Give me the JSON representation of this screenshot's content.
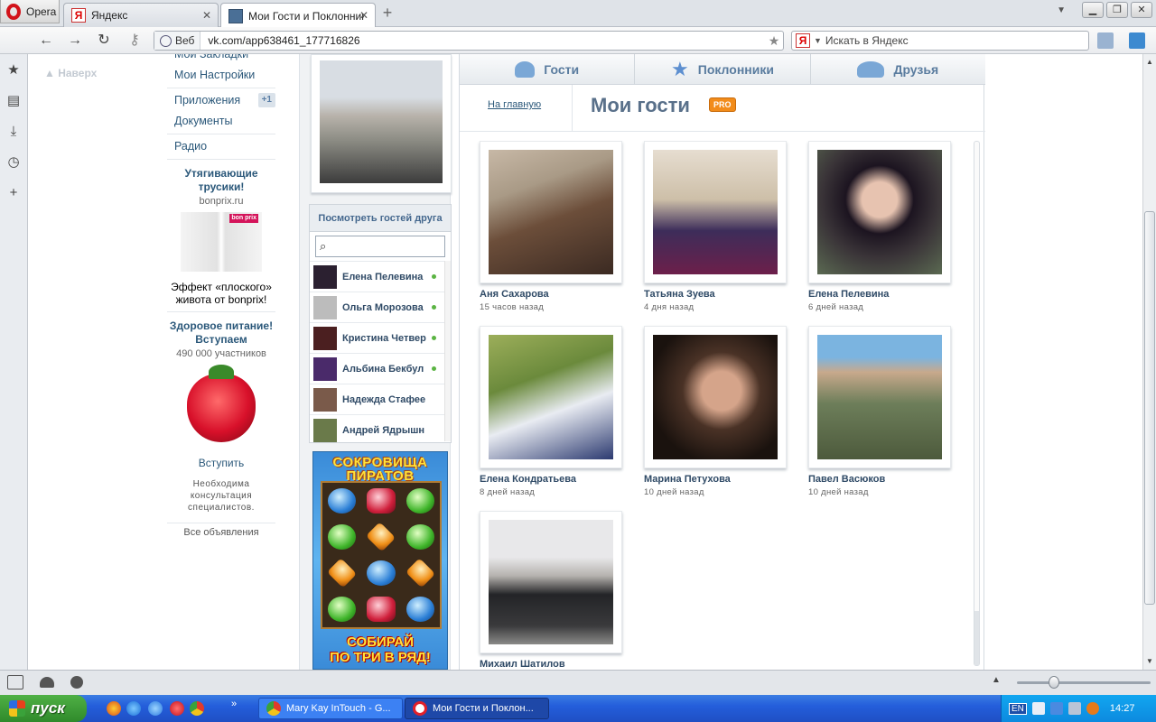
{
  "browser": {
    "menu_label": "Opera",
    "tabs": [
      {
        "title": "Яндекс",
        "favicon": "Я"
      },
      {
        "title": "Мои Гости и Поклонники"
      }
    ],
    "address": {
      "security_label": "Веб",
      "url": "vk.com/app638461_177716826"
    },
    "search": {
      "engine_letter": "Я",
      "placeholder": "Искать в Яндекс"
    }
  },
  "back_to_top": "Наверх",
  "left_menu": {
    "items": [
      {
        "label": "Мои Закладки"
      },
      {
        "label": "Мои Настройки"
      },
      {
        "label": "Приложения",
        "badge": "+1"
      },
      {
        "label": "Документы"
      },
      {
        "label": "Радио"
      }
    ]
  },
  "ads": [
    {
      "title": "Утягивающие трусики!",
      "domain": "bonprix.ru",
      "image_badge": "bon prix",
      "text": "Эффект «плоского» живота от bonprix!"
    },
    {
      "title": "Здоровое питание! Вступаем",
      "subtitle": "490 000 участников",
      "join": "Вступить",
      "note": "Необходима консультация специалистов."
    }
  ],
  "all_ads": "Все объявления",
  "friends_panel": {
    "title": "Посмотреть гостей друга",
    "friends": [
      {
        "name": "Елена Пелевина",
        "online": true
      },
      {
        "name": "Ольга Морозова",
        "online": true
      },
      {
        "name": "Кристина Четвер",
        "online": true
      },
      {
        "name": "Альбина Бекбул",
        "online": true
      },
      {
        "name": "Надежда Стафее",
        "online": false
      },
      {
        "name": "Андрей Ядрышн",
        "online": false
      }
    ]
  },
  "game_banner": {
    "title": "СОКРОВИЩА ПИРАТОВ",
    "bottom_line1": "СОБИРАЙ",
    "bottom_line2": "ПО ТРИ В РЯД!"
  },
  "app": {
    "tabs": [
      {
        "label": "Гости",
        "icon": "guests-icon"
      },
      {
        "label": "Поклонники",
        "icon": "star-icon"
      },
      {
        "label": "Друзья",
        "icon": "friends-icon"
      }
    ],
    "to_main": "На главную",
    "heading": "Мои гости",
    "pro_badge": "PRO",
    "guests": [
      {
        "name": "Аня Сахарова",
        "time": "15 часов назад"
      },
      {
        "name": "Татьяна Зуева",
        "time": "4 дня назад"
      },
      {
        "name": "Елена Пелевина",
        "time": "6 дней назад"
      },
      {
        "name": "Елена Кондратьева",
        "time": "8 дней назад"
      },
      {
        "name": "Марина Петухова",
        "time": "10 дней назад"
      },
      {
        "name": "Павел Васюков",
        "time": "10 дней назад"
      },
      {
        "name": "Михаил Шатилов",
        "time": ""
      }
    ]
  },
  "taskbar": {
    "start_label": "пуск",
    "tasks": [
      {
        "title": "Mary Kay InTouch - G..."
      },
      {
        "title": "Мои Гости и Поклон..."
      }
    ],
    "language": "EN",
    "clock": "14:27"
  }
}
